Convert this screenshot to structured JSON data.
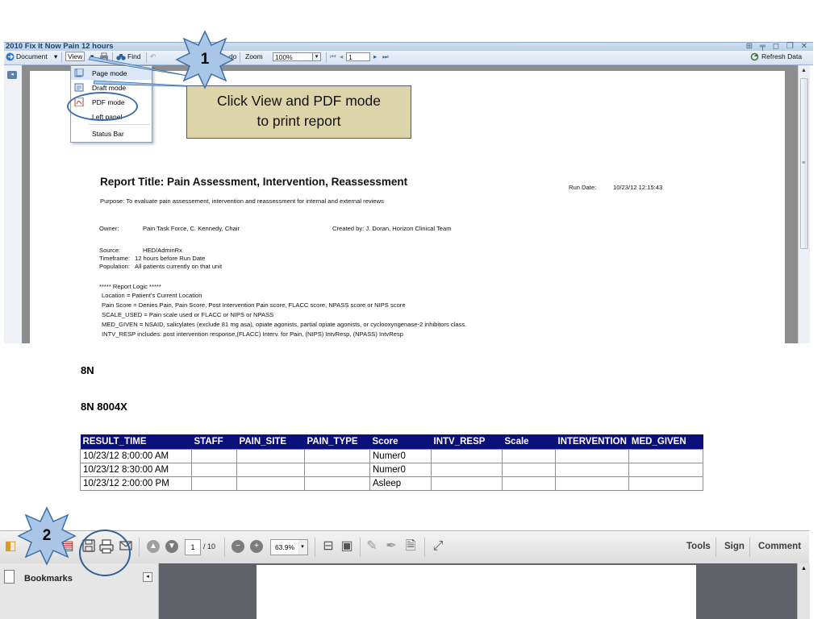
{
  "window": {
    "title": "2010 Fix It Now Pain 12 hours",
    "controls": "⊞ ╤ ◻ ❐ ✕"
  },
  "toolbar": {
    "document_label": "Document",
    "view_label": "View",
    "find_label": "Find",
    "zoom_fragment": "do",
    "zoom_label": "Zoom",
    "zoom_value": "100%",
    "page_value": "1",
    "refresh_label": "Refresh Data"
  },
  "view_menu": {
    "items": [
      "Page mode",
      "Draft mode",
      "PDF mode",
      "Left panel",
      "Status Bar"
    ]
  },
  "callout": {
    "step1": "1",
    "step2": "2",
    "text": "Click View and PDF mode\nto print report"
  },
  "report": {
    "title": "Report Title: Pain Assessment, Intervention, Reassessment",
    "purpose": "Purpose: To evaluate pain assessement, intervention and reassessment for internal and external reviews",
    "run_date_label": "Run Date:",
    "run_date_value": "10/23/12 12:15:43",
    "owner_label": "Owner:",
    "owner_value": "Pain Task Force, C. Kennedy, Chair",
    "created_by": "Created by: J. Doran, Horizon Clinical Team",
    "source_label": "Source:",
    "source_value": "HED/AdminRx",
    "timeframe_label": "Timeframe:",
    "timeframe_value": "12 hours before Run Date",
    "population_label": "Population:",
    "population_value": "All patients currently on that unit",
    "logic_header": "***** Report Logic *****",
    "logic_lines": [
      "Location = Patient's Current Location",
      "Pain Score =  Denies Pain, Pain Score, Post Intervention Pain score, FLACC score, NPASS score or NIPS score",
      "SCALE_USED = Pain scale used or FLACC or NIPS or NPASS",
      "MED_GIVEN = NSAID, salicylates (exclude 81 mg asa), opiate agonists, partial opiate agonists,  or cyclooxyngenase-2 inhibitors class.",
      "INTV_RESP includes: post intervention response,(FLACC) Interv. for Pain, (NIPS) IntvResp, (NPASS) IntvResp"
    ]
  },
  "unit": {
    "name": "8N",
    "room": "8N 8004X"
  },
  "table": {
    "headers": [
      "RESULT_TIME",
      "STAFF",
      "PAIN_SITE",
      "PAIN_TYPE",
      "Score",
      "INTV_RESP",
      "Scale",
      "INTERVENTION",
      "MED_GIVEN"
    ],
    "rows": [
      [
        "10/23/12 8:00:00 AM",
        "",
        "",
        "",
        "Numer0",
        "",
        "",
        "",
        ""
      ],
      [
        "10/23/12 8:30:00 AM",
        "",
        "",
        "",
        "Numer0",
        "",
        "",
        "",
        ""
      ],
      [
        "10/23/12 2:00:00 PM",
        "",
        "",
        "",
        "Asleep",
        "",
        "",
        "",
        ""
      ]
    ]
  },
  "pdf_viewer": {
    "page_current": "1",
    "page_total": "/ 10",
    "zoom": "63.9%",
    "tools_label": "Tools",
    "sign_label": "Sign",
    "comment_label": "Comment",
    "bookmarks_label": "Bookmarks"
  },
  "colors": {
    "table_header_bg": "#0b0f7a",
    "callout_bg": "#ddd5a9",
    "star_fill": "#a9c6e6",
    "ellipse": "#3b6fa8"
  }
}
